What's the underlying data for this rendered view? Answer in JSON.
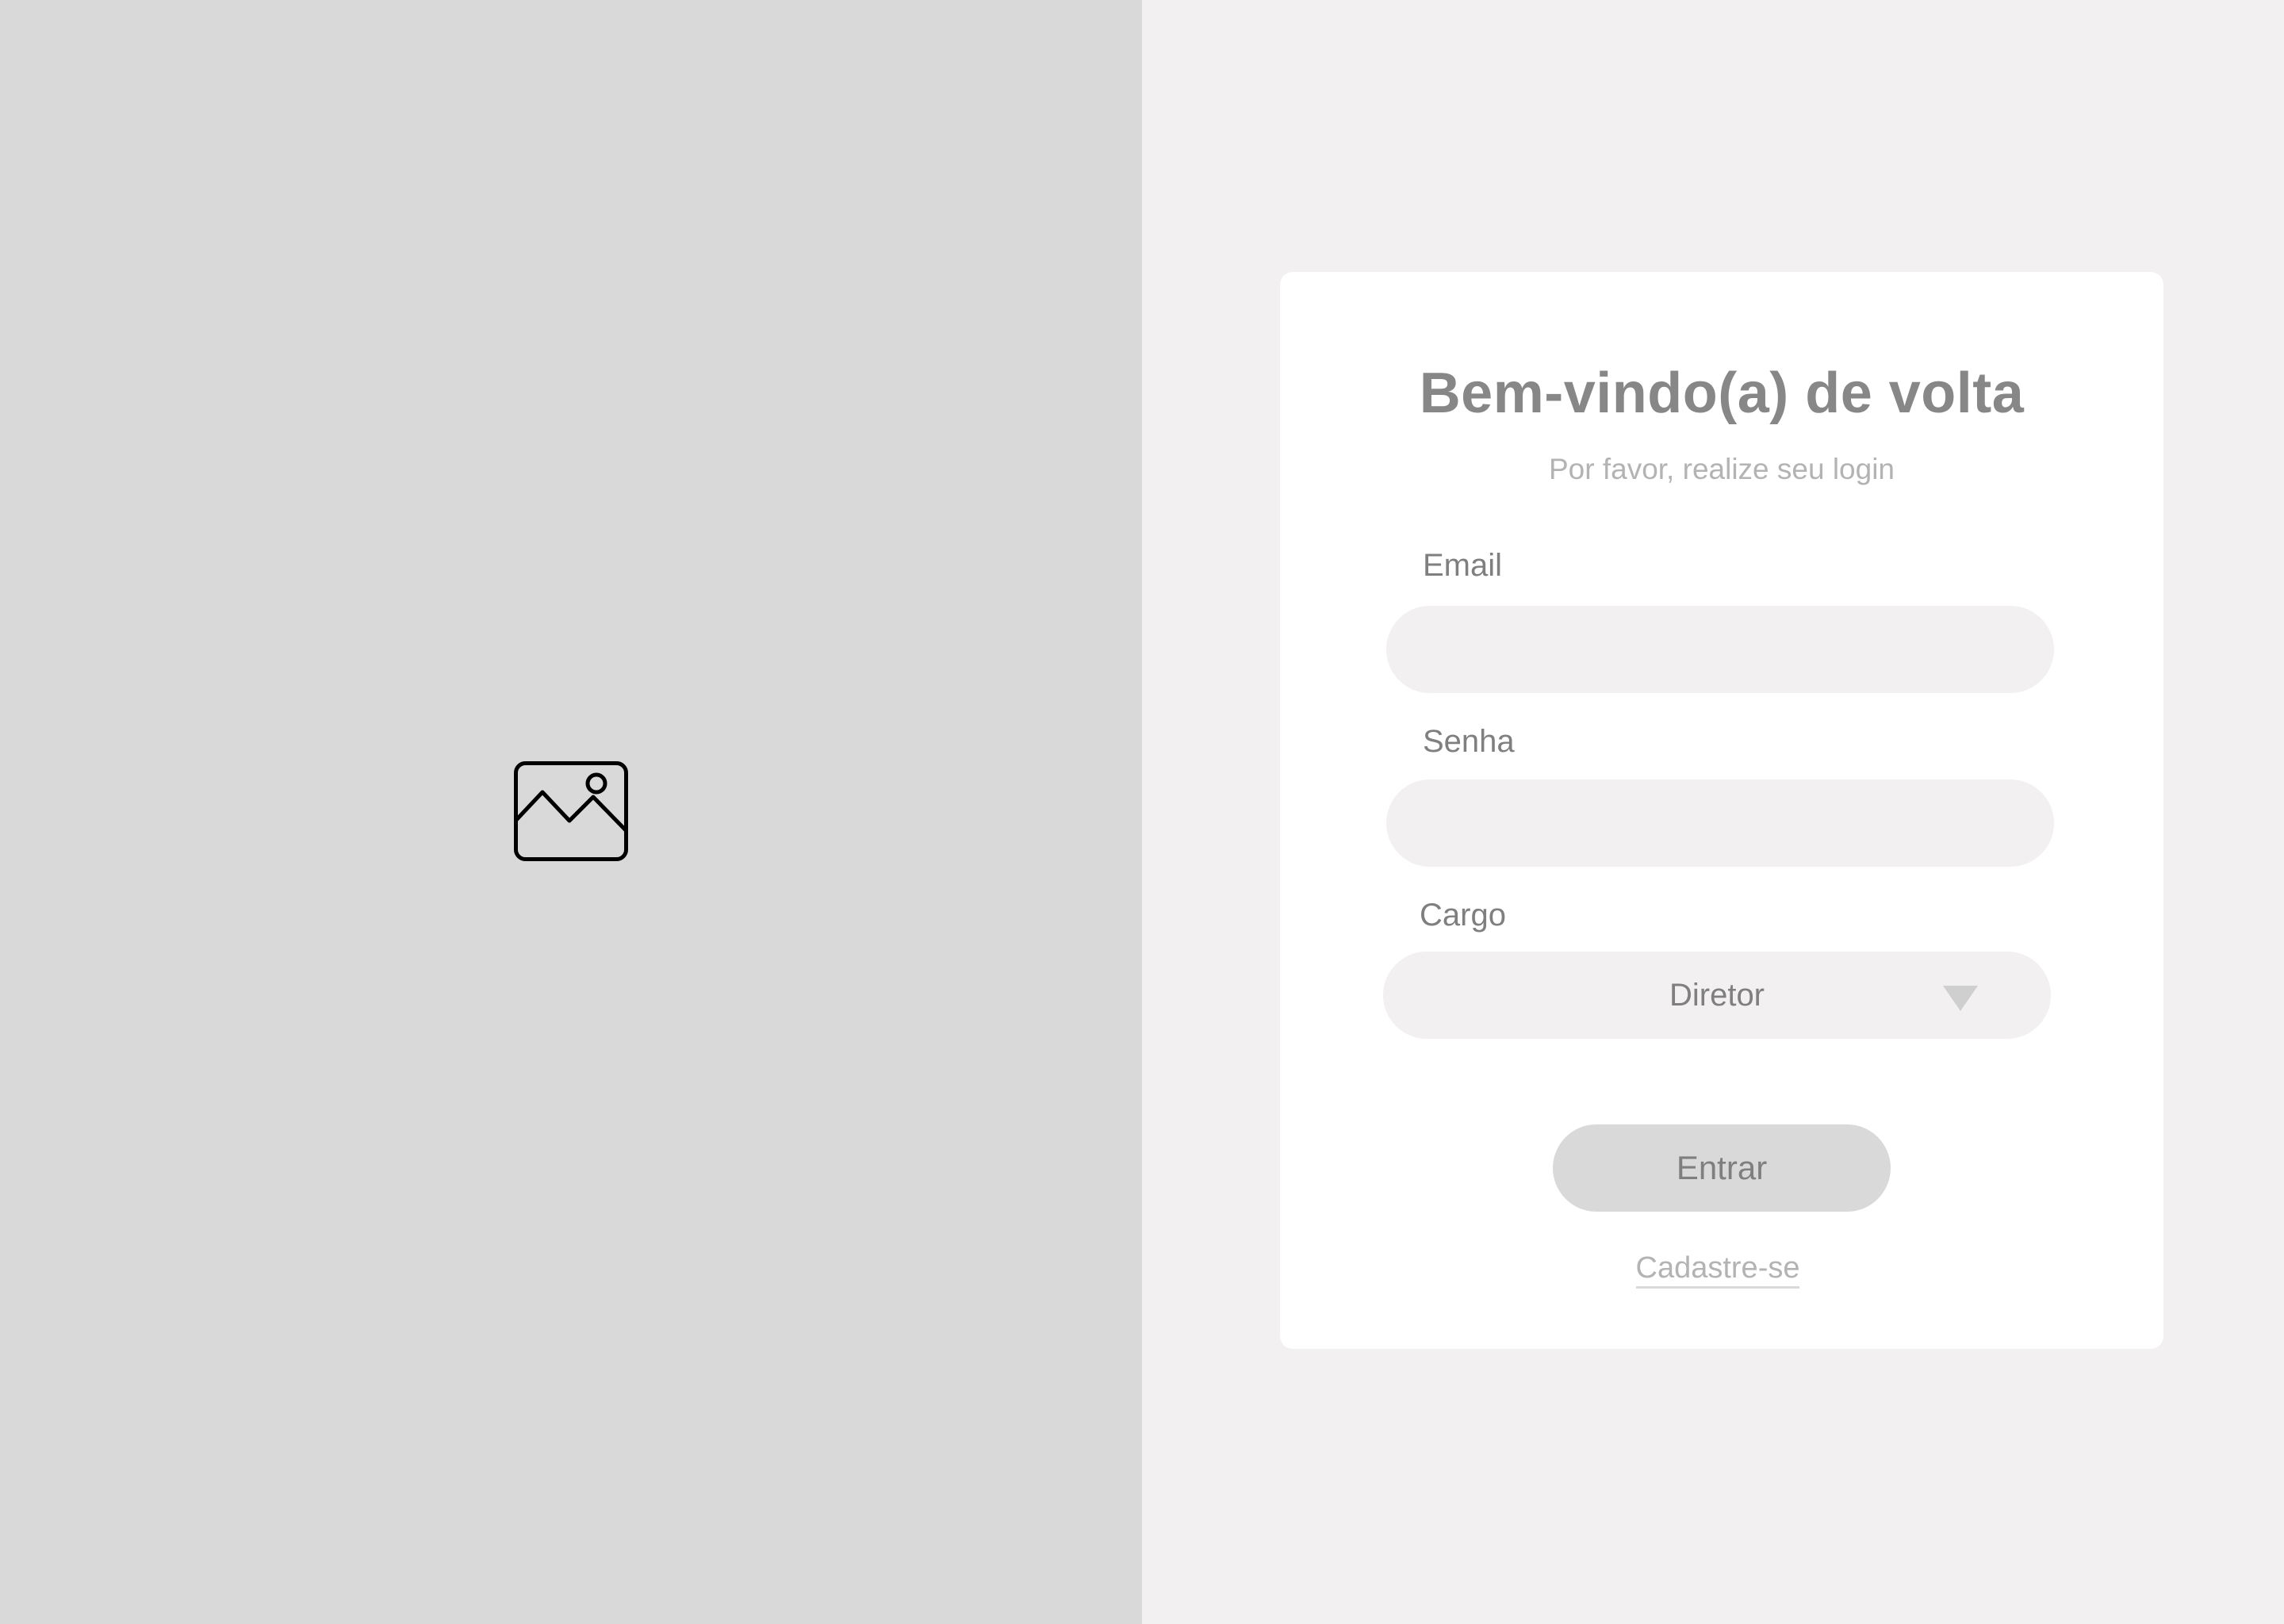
{
  "illustration": {
    "icon": "image-placeholder-icon",
    "background_color": "#d9d9d9"
  },
  "login": {
    "title": "Bem-vindo(a) de volta",
    "subtitle": "Por favor, realize seu login",
    "email": {
      "label": "Email",
      "value": "",
      "placeholder": ""
    },
    "password": {
      "label": "Senha",
      "value": "",
      "placeholder": ""
    },
    "role": {
      "label": "Cargo",
      "selected": "Diretor",
      "icon": "triangle-down-icon"
    },
    "submit_label": "Entrar",
    "signup_label": "Cadastre-se"
  },
  "colors": {
    "page_background": "#f2f0f0",
    "card_background": "#ffffff",
    "input_background": "#f2f0f0",
    "button_background": "#d9d9d9",
    "text_primary": "#878787",
    "text_muted": "#b3b3b3"
  }
}
